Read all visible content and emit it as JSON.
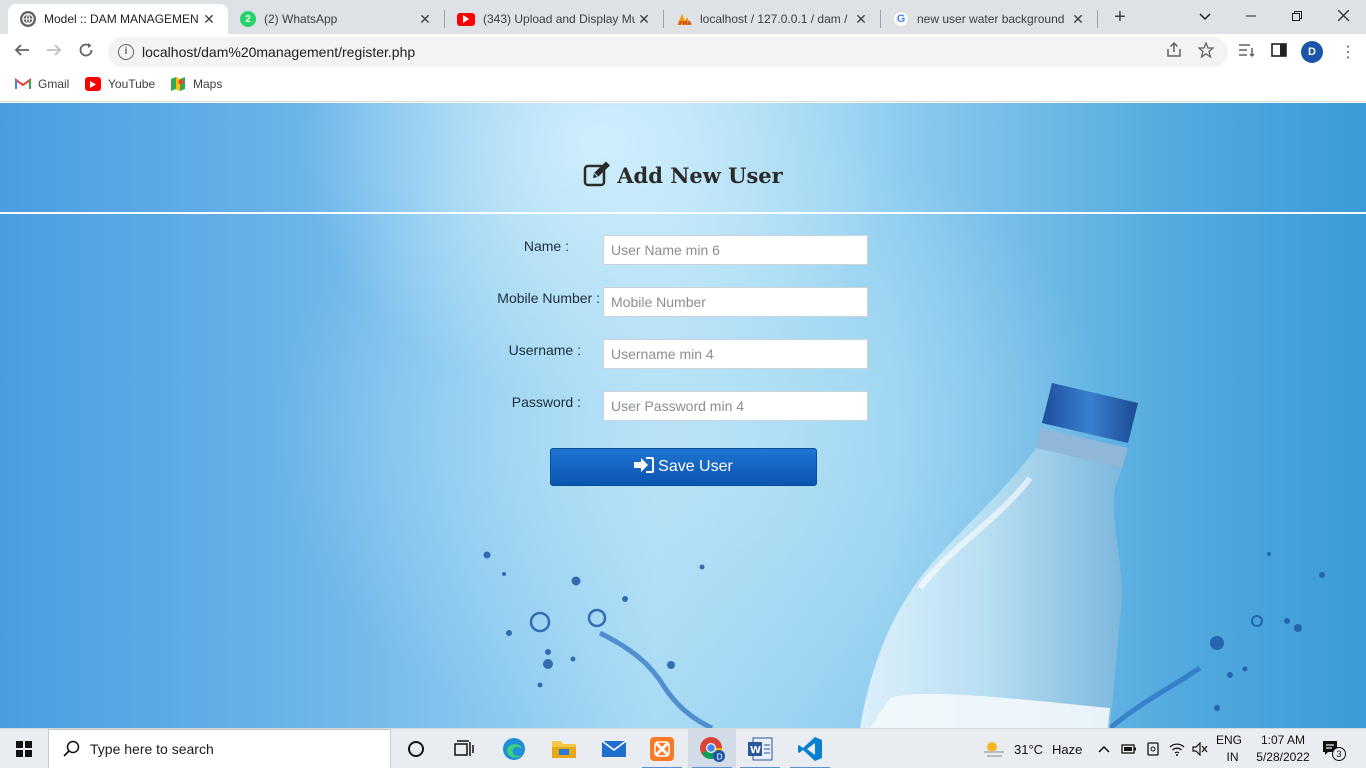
{
  "browser": {
    "tabs": [
      {
        "title": "Model :: DAM MANAGEMEN",
        "favicon": "globe-icon",
        "active": true
      },
      {
        "title": "(2) WhatsApp",
        "favicon": "whatsapp-icon",
        "badge": "2"
      },
      {
        "title": "(343) Upload and Display Mu",
        "favicon": "youtube-icon"
      },
      {
        "title": "localhost / 127.0.0.1 / dam /",
        "favicon": "phpmyadmin-icon"
      },
      {
        "title": "new user water background",
        "favicon": "google-icon"
      }
    ],
    "url": "localhost/dam%20management/register.php",
    "profile_initial": "D",
    "bookmarks": [
      {
        "label": "Gmail",
        "icon": "gmail-icon"
      },
      {
        "label": "YouTube",
        "icon": "youtube-icon"
      },
      {
        "label": "Maps",
        "icon": "maps-icon"
      }
    ]
  },
  "form": {
    "title": "Add New User",
    "fields": [
      {
        "label": "Name :",
        "placeholder": "User Name min 6",
        "value": ""
      },
      {
        "label": "Mobile Number :",
        "placeholder": "Mobile Number",
        "value": ""
      },
      {
        "label": "Username :",
        "placeholder": "Username min 4",
        "value": ""
      },
      {
        "label": "Password :",
        "placeholder": "User Password min 4",
        "value": ""
      }
    ],
    "submit_label": "Save User"
  },
  "taskbar": {
    "search_placeholder": "Type here to search",
    "weather_temp": "31°C",
    "weather_text": "Haze",
    "language_top": "ENG",
    "language_bottom": "IN",
    "time": "1:07 AM",
    "date": "5/28/2022",
    "notification_count": "3"
  },
  "colors": {
    "button_blue": "#0b55b0",
    "accent": "#1a73e8"
  }
}
